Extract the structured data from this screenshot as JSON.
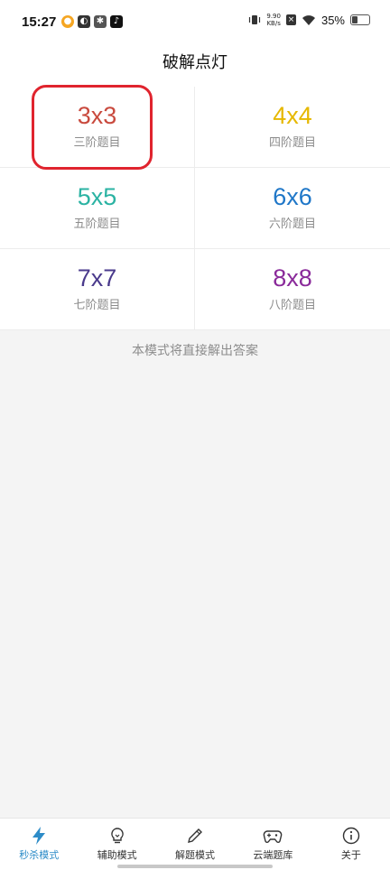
{
  "status": {
    "time": "15:27",
    "net_speed_value": "9.90",
    "net_speed_unit": "KB/s",
    "battery": "35%",
    "battery_level": 0.35
  },
  "header": {
    "title": "破解点灯"
  },
  "grid": {
    "items": [
      {
        "size": "3x3",
        "label": "三阶题目",
        "color": "#c94a3e"
      },
      {
        "size": "4x4",
        "label": "四阶题目",
        "color": "#e6b800"
      },
      {
        "size": "5x5",
        "label": "五阶题目",
        "color": "#2bb3a3"
      },
      {
        "size": "6x6",
        "label": "六阶题目",
        "color": "#1f77c8"
      },
      {
        "size": "7x7",
        "label": "七阶题目",
        "color": "#4a3a8c"
      },
      {
        "size": "8x8",
        "label": "八阶题目",
        "color": "#8a2a9a"
      }
    ]
  },
  "mode_note": "本模式将直接解出答案",
  "bottom_nav": {
    "items": [
      {
        "label": "秒杀模式",
        "icon": "lightning-icon",
        "active": true
      },
      {
        "label": "辅助模式",
        "icon": "lightbulb-icon",
        "active": false
      },
      {
        "label": "解题模式",
        "icon": "pencil-icon",
        "active": false
      },
      {
        "label": "云端题库",
        "icon": "gamepad-icon",
        "active": false
      },
      {
        "label": "关于",
        "icon": "info-icon",
        "active": false
      }
    ]
  },
  "colors": {
    "accent": "#2d8cc8",
    "highlight": "#e0242e"
  }
}
